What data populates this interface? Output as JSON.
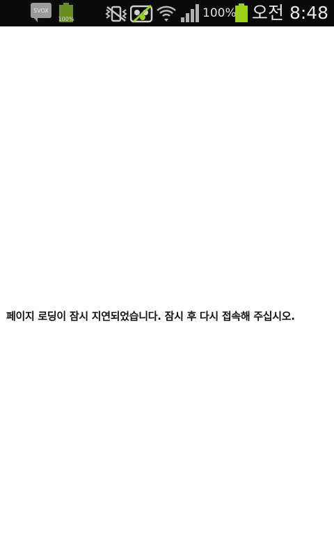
{
  "status_bar": {
    "svox_label": "SVOX",
    "small_battery_label": "100%",
    "battery_percent_text": "100%",
    "clock_text": "오전 8:48",
    "icons": [
      "svox-notification-icon",
      "battery-full-icon",
      "vibrate-mute-icon",
      "screen-mirroring-off-icon",
      "wifi-icon",
      "signal-strength-icon",
      "battery-icon"
    ],
    "battery_level": 1.0,
    "accent_green": "#9bd11b"
  },
  "page": {
    "message": "페이지 로딩이 잠시 지연되었습니다. 잠시 후 다시 접속해 주십시오."
  }
}
